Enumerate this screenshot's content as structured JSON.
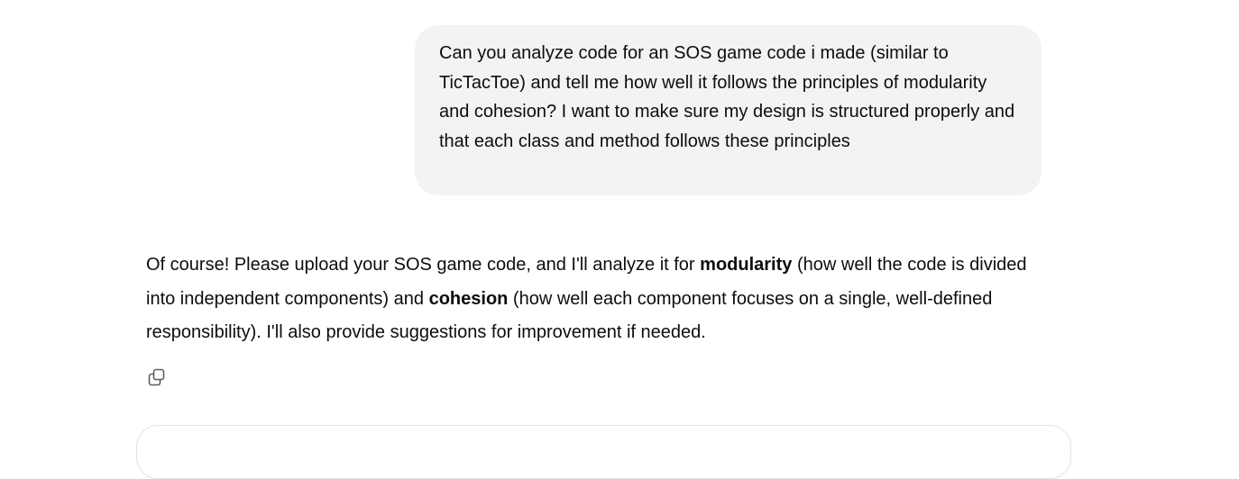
{
  "conversation": {
    "user_message": "Can you analyze code for an SOS game code i made (similar to TicTacToe) and tell me how well it follows the principles of modularity and cohesion? I want to make sure my design is structured properly and that each class and method follows these principles",
    "assistant_message": {
      "part1": "Of course! Please upload your SOS game code, and I'll analyze it for ",
      "bold1": "modularity",
      "part2": " (how well the code is divided into independent components) and ",
      "bold2": "cohesion",
      "part3": " (how well each component focuses on a single, well-defined responsibility). I'll also provide suggestions for improvement if needed."
    },
    "actions": {
      "copy_icon": "copy-icon"
    }
  }
}
